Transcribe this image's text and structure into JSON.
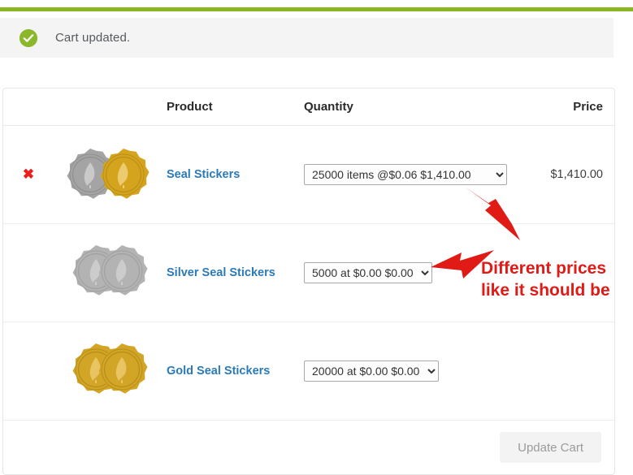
{
  "theme": {
    "accent_bar_color": "#8bb822",
    "notice_bg": "#f4f4f4",
    "link_color": "#2a7ab9",
    "annotation_color": "#e01b16",
    "remove_icon_color": "#ee1c1c",
    "silver_seal_color": "#a6a6a6",
    "gold_seal_color": "#d4a422"
  },
  "notice": {
    "icon": "check-circle-icon",
    "message": "Cart updated."
  },
  "cart": {
    "headers": {
      "remove": "",
      "thumbnail": "",
      "product": "Product",
      "quantity": "Quantity",
      "price": "Price"
    },
    "rows": [
      {
        "remove_icon": "remove-x-icon",
        "remove_label": "✖",
        "thumbnail": "silver-and-gold-seal-sticker-image",
        "product_name": "Seal Stickers",
        "quantity_option": "25000 items @$0.06 $1,410.00",
        "price": "$1,410.00"
      },
      {
        "remove_icon": "",
        "remove_label": "",
        "thumbnail": "silver-seal-sticker-image",
        "product_name": "Silver Seal Stickers",
        "quantity_option": "5000 at $0.00 $0.00",
        "price": ""
      },
      {
        "remove_icon": "",
        "remove_label": "",
        "thumbnail": "gold-seal-sticker-image",
        "product_name": "Gold Seal Stickers",
        "quantity_option": "20000 at $0.00 $0.00",
        "price": ""
      }
    ],
    "update_button_label": "Update Cart"
  },
  "annotations": {
    "line1": "Different prices",
    "line2": "like it should be",
    "arrow_1": "red-arrow-pointing-to-first-quantity-dropdown",
    "arrow_2": "red-arrow-pointing-to-second-quantity-dropdown"
  }
}
